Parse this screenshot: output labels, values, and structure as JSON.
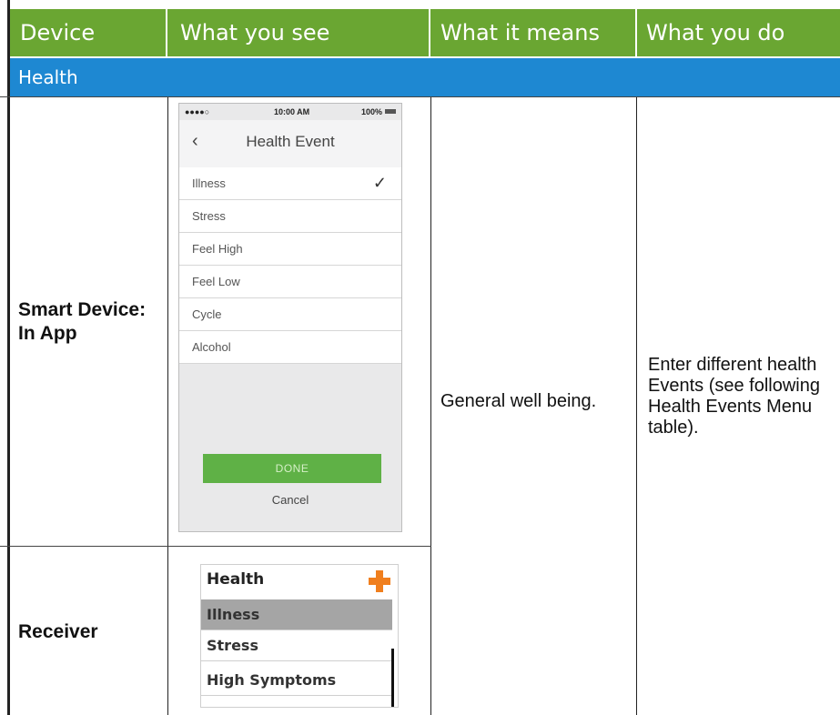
{
  "header": {
    "device": "Device",
    "what_you_see": "What you see",
    "what_it_means": "What it means",
    "what_you_do": "What you do"
  },
  "section": {
    "title": "Health"
  },
  "rows": {
    "smart_device_label": "Smart Device:\nIn App",
    "receiver_label": "Receiver",
    "meaning": "General well being.",
    "action": "Enter different health Events (see following Health Events Menu table)."
  },
  "phone": {
    "signal": "●●●●○",
    "time": "10:00 AM",
    "battery": "100%",
    "title": "Health Event",
    "items": [
      "Illness",
      "Stress",
      "Feel High",
      "Feel Low",
      "Cycle",
      "Alcohol"
    ],
    "selected_index": 0,
    "done_label": "DONE",
    "cancel_label": "Cancel"
  },
  "receiver": {
    "title": "Health",
    "items": [
      "Illness",
      "Stress",
      "High Symptoms"
    ],
    "selected_index": 0
  },
  "colors": {
    "header_bg": "#6aa632",
    "section_bg": "#1e88d2",
    "done_btn": "#5fb146",
    "plus_icon": "#f07f1e"
  }
}
